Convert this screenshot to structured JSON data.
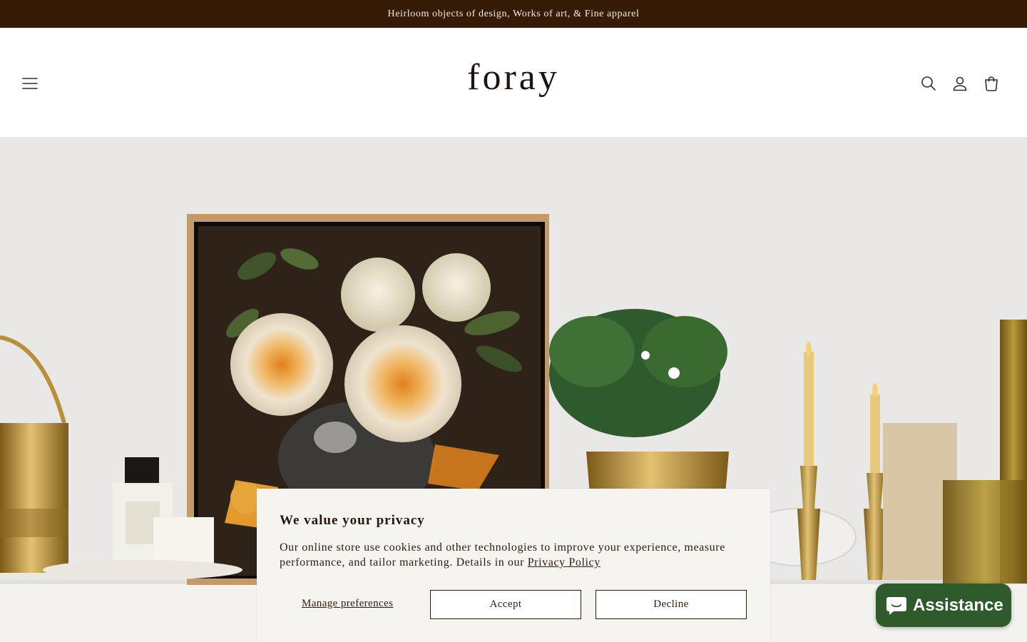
{
  "announcement": {
    "text": "Heirloom objects of design, Works of art, & Fine apparel"
  },
  "header": {
    "logo": "foray",
    "icons": [
      "menu-icon",
      "search-icon",
      "account-icon",
      "cart-icon"
    ]
  },
  "hero": {
    "description": "still life on white shelf",
    "colors": {
      "wall": "#e9e8e6",
      "shelf": "#f2f1ef",
      "frame": "#c49a6c",
      "painting_bg": "#2d2118"
    }
  },
  "cookie_banner": {
    "title": "We value your privacy",
    "body": "Our online store use cookies and other technologies to improve your experience, measure performance, and tailor marketing. Details in our",
    "link": "Privacy Policy",
    "manage_label": "Manage preferences",
    "accept_label": "Accept",
    "decline_label": "Decline"
  },
  "assistant": {
    "label": "Assistance",
    "icon": "chat-bubble-icon",
    "color": "#2f5b2c"
  },
  "colors": {
    "announcement_bg": "#361c06",
    "text": "#2b1a0e",
    "banner_bg": "#f6f4f0"
  }
}
